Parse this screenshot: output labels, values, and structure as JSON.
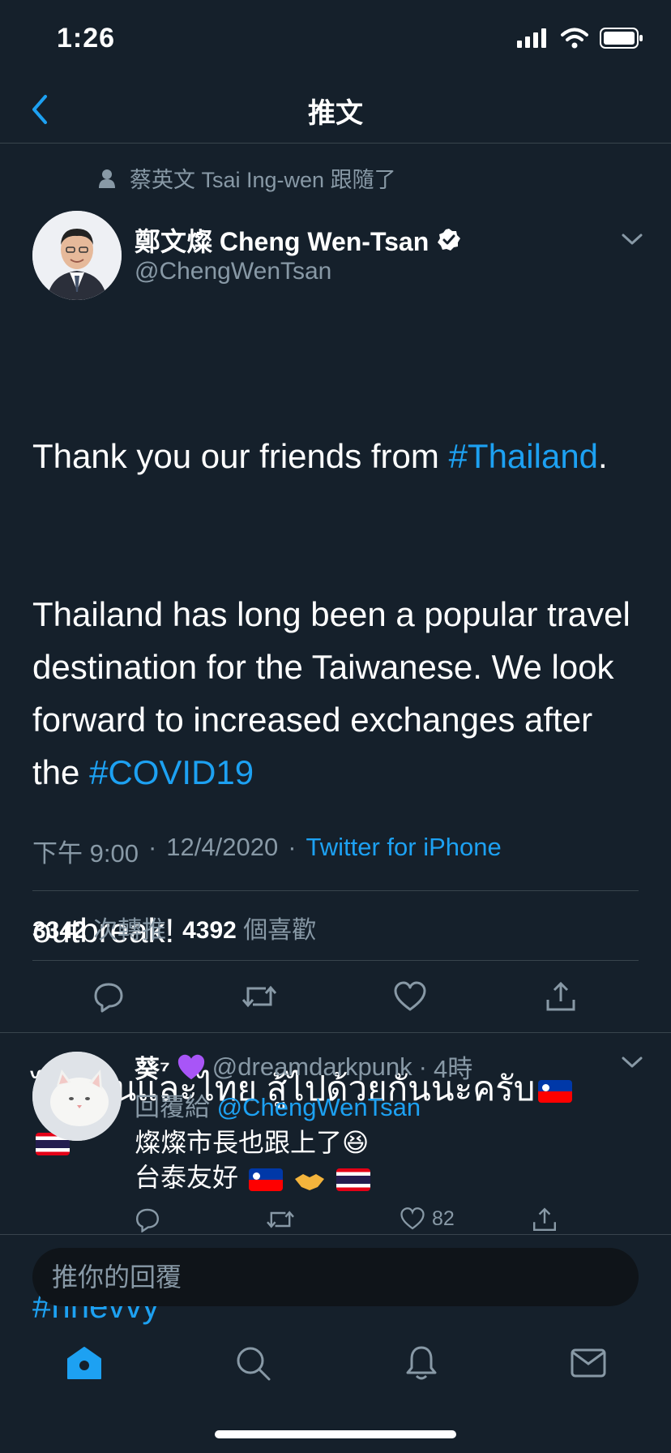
{
  "status_bar": {
    "time": "1:26"
  },
  "nav": {
    "title": "推文"
  },
  "retweet_context": {
    "text": "蔡英文 Tsai Ing-wen 跟隨了"
  },
  "tweet": {
    "author_name": "鄭文燦 Cheng Wen-Tsan",
    "handle": "@ChengWenTsan",
    "line1_before": "Thank you our friends from ",
    "hashtag_thailand": "#Thailand",
    "line1_after": ".",
    "paragraph2": "Thailand has long been a popular travel destination for the Taiwanese. We look forward to increased exchanges after the ",
    "hashtag_covid": "#COVID19",
    "paragraph3": "outbreak!",
    "thai_text": "ไต้หวันและไทย สู้ไปด้วยกันนะครับ",
    "hashtag_thai": "#nnevvy",
    "timestamp": "下午 9:00",
    "date": "12/4/2020",
    "source": "Twitter for iPhone",
    "retweets_count": "3342",
    "retweets_label": "次轉推",
    "likes_count": "4392",
    "likes_label": "個喜歡"
  },
  "reply": {
    "name": "葵⁷",
    "handle": "@dreamdarkpunk",
    "time": "4時",
    "reply_prefix": "回覆給",
    "reply_to": "@ChengWenTsan",
    "text_line1": "燦燦市長也跟上了😆",
    "text_line2": "台泰友好",
    "likes": "82"
  },
  "compose": {
    "placeholder": "推你的回覆"
  },
  "icons": [
    "back-icon",
    "person-icon",
    "verified-icon",
    "chevron-down-icon",
    "reply-icon",
    "retweet-icon",
    "like-icon",
    "share-icon",
    "home-icon",
    "search-icon",
    "notifications-icon",
    "messages-icon"
  ],
  "colors": {
    "background": "#15202b",
    "accent": "#1da1f2",
    "muted": "#8899a6",
    "divider": "#38444d"
  }
}
